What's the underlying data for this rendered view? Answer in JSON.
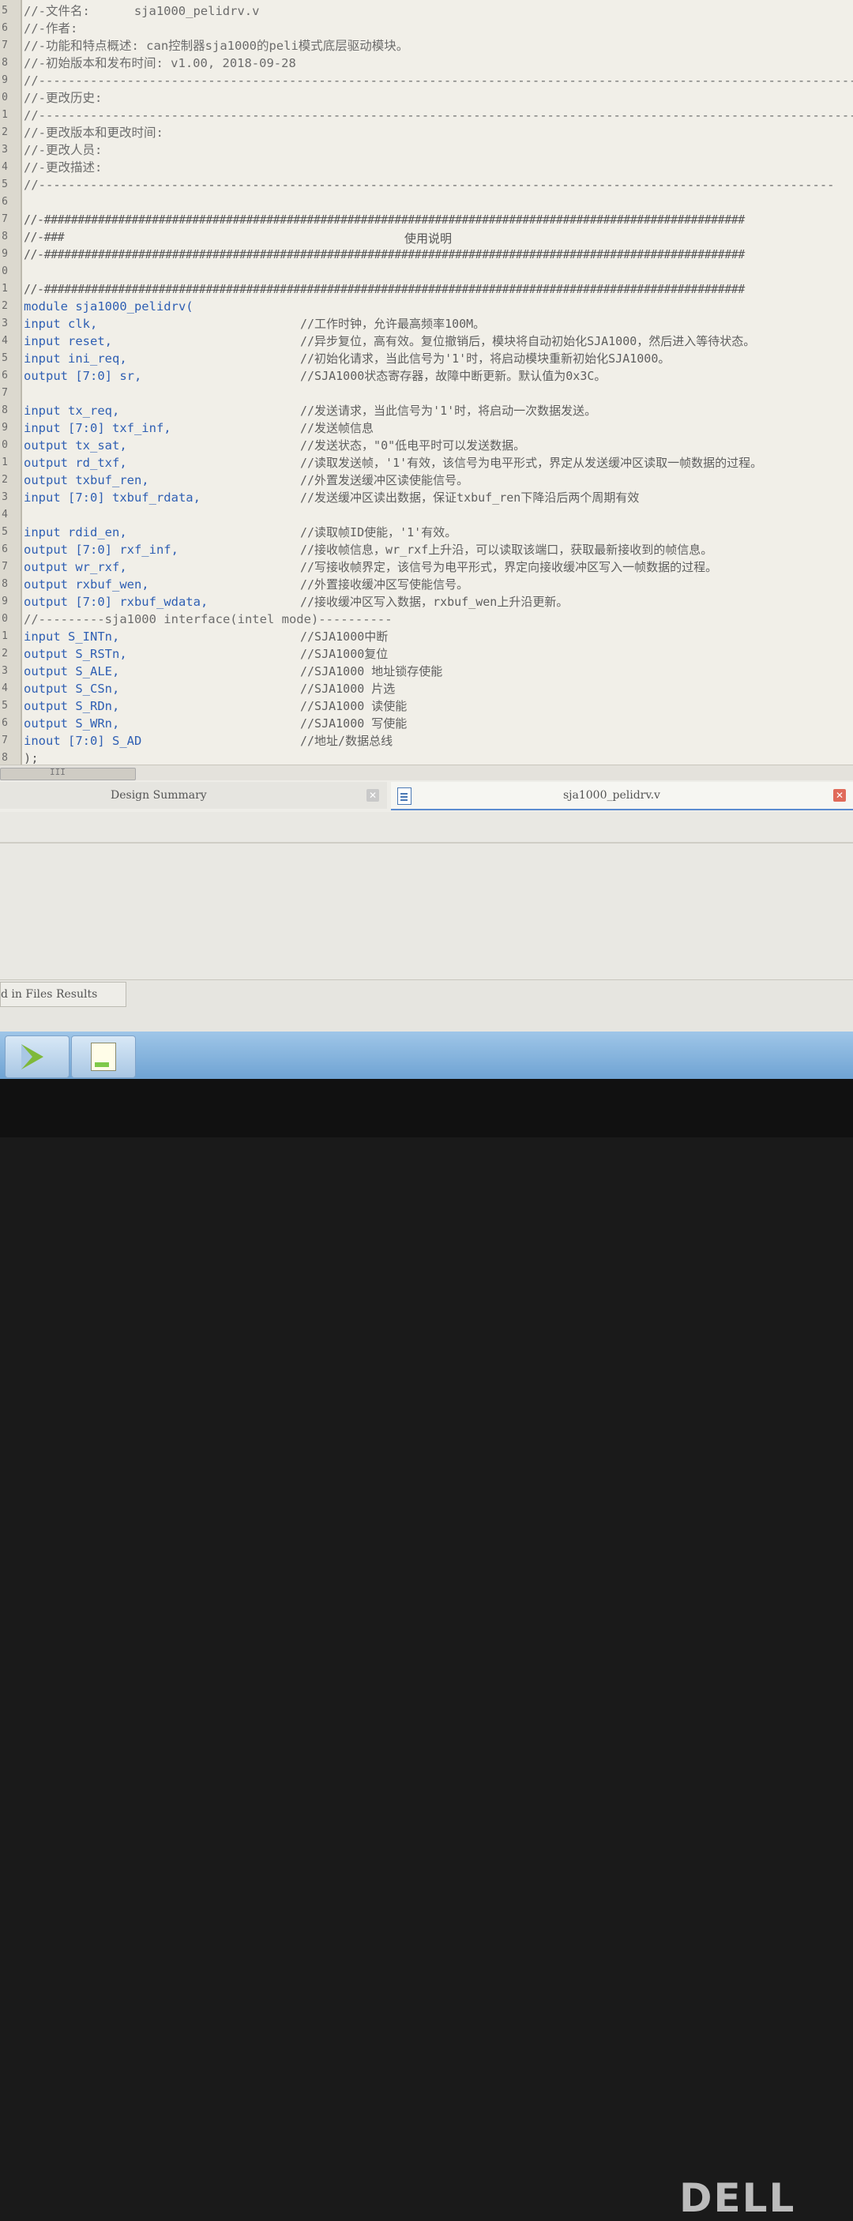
{
  "editor": {
    "line_numbers": [
      "5",
      "6",
      "7",
      "8",
      "9",
      "0",
      "1",
      "2",
      "3",
      "4",
      "5",
      "6",
      "7",
      "8",
      "9",
      "0",
      "1",
      "2",
      "3",
      "4",
      "5",
      "6",
      "7",
      "8",
      "9",
      "0",
      "1",
      "2",
      "3",
      "4",
      "5",
      "6",
      "7",
      "8",
      "9",
      "0",
      "1",
      "2",
      "3",
      "4",
      "5",
      "6",
      "7",
      "8"
    ],
    "header_lines": [
      "//-文件名:      sja1000_pelidrv.v",
      "//-作者:",
      "//-功能和特点概述: can控制器sja1000的peli模式底层驱动模块。",
      "//-初始版本和发布时间: v1.00, 2018-09-28",
      "//-----------------------------------------------------------------------------------------------------------------------------",
      "//-更改历史:",
      "//---------------------------------------------------------------------------------------------------------------",
      "//-更改版本和更改时间:",
      "//-更改人员:",
      "//-更改描述:",
      "//------------------------------------------------------------------------------------------------------------"
    ],
    "hash_line": "//-########################################################################################################",
    "usage_prefix": "//-###",
    "usage_title": "使用说明",
    "module_decl": "module sja1000_pelidrv(",
    "ports_group1": [
      {
        "code": "input clk,",
        "comment": "//工作时钟，允许最高频率100M。"
      },
      {
        "code": "input reset,",
        "comment": "//异步复位，高有效。复位撤销后，模块将自动初始化SJA1000，然后进入等待状态。"
      },
      {
        "code": "input ini_req,",
        "comment": "//初始化请求，当此信号为'1'时，将启动模块重新初始化SJA1000。"
      },
      {
        "code": "output [7:0] sr,",
        "comment": "//SJA1000状态寄存器，故障中断更新。默认值为0x3C。"
      }
    ],
    "ports_group2": [
      {
        "code": "input tx_req,",
        "comment": "//发送请求，当此信号为'1'时，将启动一次数据发送。"
      },
      {
        "code": "input [7:0] txf_inf,",
        "comment": "//发送帧信息"
      },
      {
        "code": "output tx_sat,",
        "comment": "//发送状态，\"0\"低电平时可以发送数据。"
      },
      {
        "code": "output rd_txf,",
        "comment": "//读取发送帧，'1'有效，该信号为电平形式，界定从发送缓冲区读取一帧数据的过程。"
      },
      {
        "code": "output txbuf_ren,",
        "comment": "//外置发送缓冲区读使能信号。"
      },
      {
        "code": "input [7:0] txbuf_rdata,",
        "comment": "//发送缓冲区读出数据，保证txbuf_ren下降沿后两个周期有效"
      }
    ],
    "ports_group3": [
      {
        "code": "input rdid_en,",
        "comment": "//读取帧ID使能，'1'有效。"
      },
      {
        "code": "output [7:0] rxf_inf,",
        "comment": "//接收帧信息，wr_rxf上升沿，可以读取该端口，获取最新接收到的帧信息。"
      },
      {
        "code": "output wr_rxf,",
        "comment": "//写接收帧界定，该信号为电平形式，界定向接收缓冲区写入一帧数据的过程。"
      },
      {
        "code": "output rxbuf_wen,",
        "comment": "//外置接收缓冲区写使能信号。"
      },
      {
        "code": "output [7:0] rxbuf_wdata,",
        "comment": "//接收缓冲区写入数据，rxbuf_wen上升沿更新。"
      }
    ],
    "interface_sep": "//---------sja1000 interface(intel mode)----------",
    "ports_group4": [
      {
        "code": "input S_INTn,",
        "comment": "//SJA1000中断"
      },
      {
        "code": "output S_RSTn,",
        "comment": "//SJA1000复位"
      },
      {
        "code": "output S_ALE,",
        "comment": "//SJA1000 地址锁存使能"
      },
      {
        "code": "output S_CSn,",
        "comment": "//SJA1000 片选"
      },
      {
        "code": "output S_RDn,",
        "comment": "//SJA1000 读使能"
      },
      {
        "code": "output S_WRn,",
        "comment": "//SJA1000 写使能"
      },
      {
        "code": "inout [7:0] S_AD",
        "comment": "//地址/数据总线"
      }
    ],
    "close": ");"
  },
  "scrollbar": {
    "thumb_grip": "III"
  },
  "tabs": {
    "tab1_label": "Design Summary",
    "tab2_label": "sja1000_pelidrv.v",
    "close_symbol": "✕"
  },
  "results": {
    "tab_label": "d in Files Results"
  },
  "taskbar": {
    "items": [
      "ise-app",
      "notepad-app"
    ]
  },
  "bezel": {
    "brand": "DELL"
  }
}
